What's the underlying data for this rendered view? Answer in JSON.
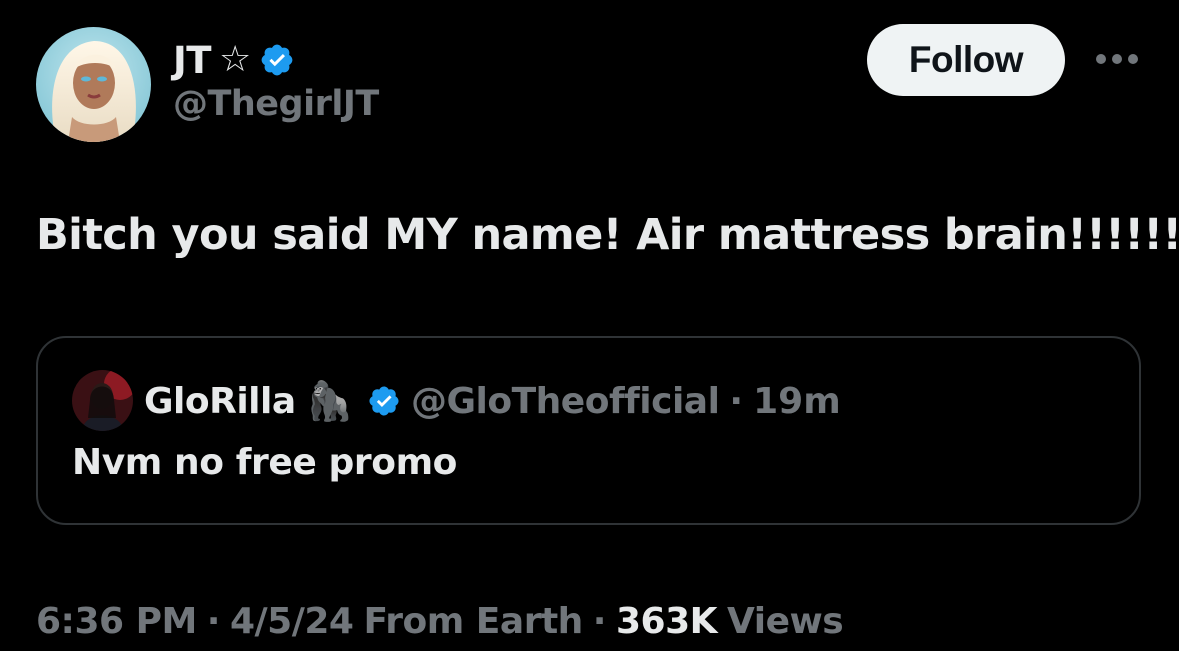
{
  "colors": {
    "background": "#000000",
    "text_primary": "#e7e9ea",
    "text_secondary": "#71767b",
    "verified_blue": "#1d9bf0",
    "follow_button_bg": "#eff3f4",
    "follow_button_text": "#0f1419",
    "card_border": "#2f3336"
  },
  "author": {
    "display_name": "JT",
    "star_glyph": "☆",
    "handle": "@ThegirlJT",
    "verified_icon": "verified-badge-icon",
    "avatar_icon": "avatar-photo"
  },
  "header": {
    "follow_label": "Follow",
    "more_icon": "more-options-icon"
  },
  "tweet": {
    "text": "Bitch you said MY name! Air mattress brain!!!!!!"
  },
  "quoted_tweet": {
    "display_name": "GloRilla",
    "emoji": "🦍",
    "handle": "@GloTheofficial",
    "separator": "·",
    "time": "19m",
    "text": "Nvm no free promo"
  },
  "meta": {
    "time": "6:36 PM",
    "separator1": "·",
    "date": "4/5/24",
    "source": "From Earth",
    "separator2": "·",
    "views_count": "363K",
    "views_label": "Views"
  }
}
